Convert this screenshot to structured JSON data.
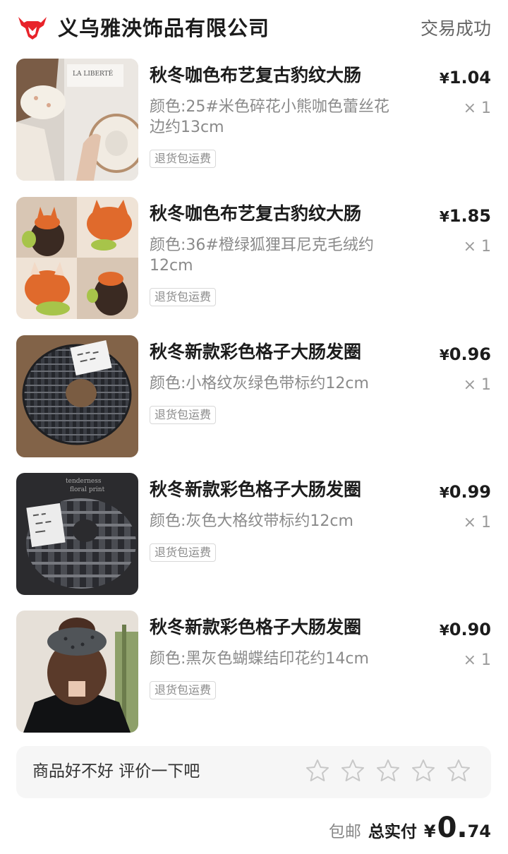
{
  "shop": {
    "name": "义乌雅泱饰品有限公司",
    "status": "交易成功",
    "logo_icon": "red-bull-head-icon",
    "logo_color": "#e8232a"
  },
  "items": [
    {
      "title": "秋冬咖色布艺复古豹纹大肠",
      "spec": "颜色:25#米色碎花小熊咖色蕾丝花边约13cm",
      "tag": "退货包运费",
      "price_currency": "¥",
      "price": "1.04",
      "qty": "× 1",
      "image_alt": "cream floral scrunchie"
    },
    {
      "title": "秋冬咖色布艺复古豹纹大肠",
      "spec": "颜色:36#橙绿狐狸耳尼克毛绒约12cm",
      "tag": "退货包运费",
      "price_currency": "¥",
      "price": "1.85",
      "qty": "× 1",
      "image_alt": "orange fox ear plush scrunchie"
    },
    {
      "title": "秋冬新款彩色格子大肠发圈",
      "spec": "颜色:小格纹灰绿色带标约12cm",
      "tag": "退货包运费",
      "price_currency": "¥",
      "price": "0.96",
      "qty": "× 1",
      "image_alt": "small plaid scrunchie"
    },
    {
      "title": "秋冬新款彩色格子大肠发圈",
      "spec": "颜色:灰色大格纹带标约12cm",
      "tag": "退货包运费",
      "price_currency": "¥",
      "price": "0.99",
      "qty": "× 1",
      "image_alt": "grey large plaid scrunchie"
    },
    {
      "title": "秋冬新款彩色格子大肠发圈",
      "spec": "颜色:黑灰色蝴蝶结印花约14cm",
      "tag": "退货包运费",
      "price_currency": "¥",
      "price": "0.90",
      "qty": "× 1",
      "image_alt": "grey printed scrunchie on hair"
    }
  ],
  "rating": {
    "prompt": "商品好不好 评价一下吧",
    "stars": 5,
    "star_icon": "star-outline-icon"
  },
  "footer": {
    "shipping": "包邮",
    "total_label": "总实付",
    "total_currency": "¥",
    "total_int": "0.",
    "total_dec": "74"
  }
}
